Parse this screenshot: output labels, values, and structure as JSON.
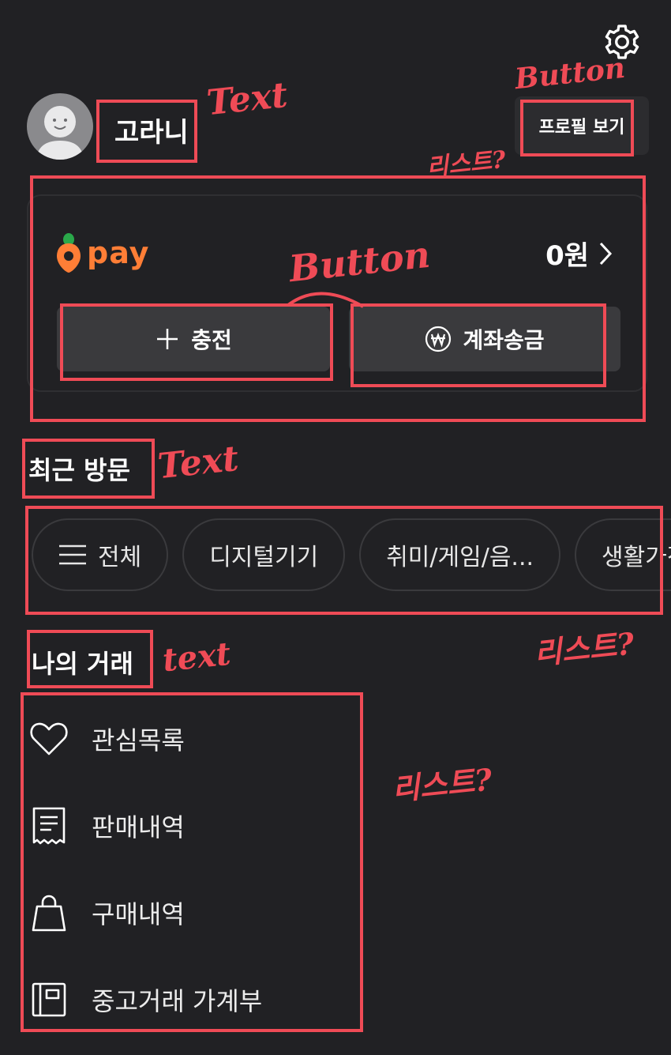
{
  "header": {
    "settings_icon": "gear-icon",
    "username": "고라니",
    "profile_button": "프로필 보기"
  },
  "pay": {
    "logo_word": "pay",
    "balance": "0원",
    "charge_label": "충전",
    "transfer_label": "계좌송금",
    "accent": "#ff7e36"
  },
  "recent": {
    "title": "최근 방문",
    "chips": [
      "전체",
      "디지털기기",
      "취미/게임/음...",
      "생활가전"
    ]
  },
  "trades": {
    "title": "나의 거래",
    "items": [
      "관심목록",
      "판매내역",
      "구매내역",
      "중고거래 가계부"
    ]
  },
  "annotations": {
    "text1": "Text",
    "button1": "Button",
    "list1": "리스트?",
    "button2": "Button",
    "text2": "Text",
    "list2": "리스트?",
    "text3": "text",
    "list3": "리스트?",
    "color": "#ef4b56"
  }
}
